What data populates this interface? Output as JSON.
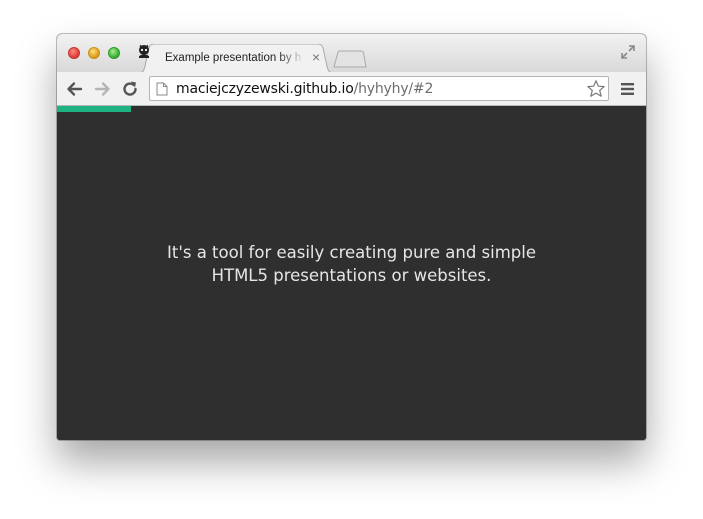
{
  "browser": {
    "tab": {
      "title": "Example presentation by h",
      "close_glyph": "×",
      "favicon": "octocat-icon"
    },
    "address_bar": {
      "host": "maciejczyzewski.github.io",
      "path": "/hyhyhy/#2"
    },
    "toolbar_icons": [
      "back-arrow-icon",
      "forward-arrow-icon",
      "reload-icon",
      "page-icon",
      "star-icon",
      "menu-icon"
    ]
  },
  "slide": {
    "line1": "It's a tool for easily creating pure and simple",
    "line2": "HTML5 presentations or websites.",
    "background_color": "#2f2f2f",
    "text_color": "#e6e6e6"
  },
  "progress": {
    "fraction": 0.125,
    "color": "#1fb383"
  }
}
